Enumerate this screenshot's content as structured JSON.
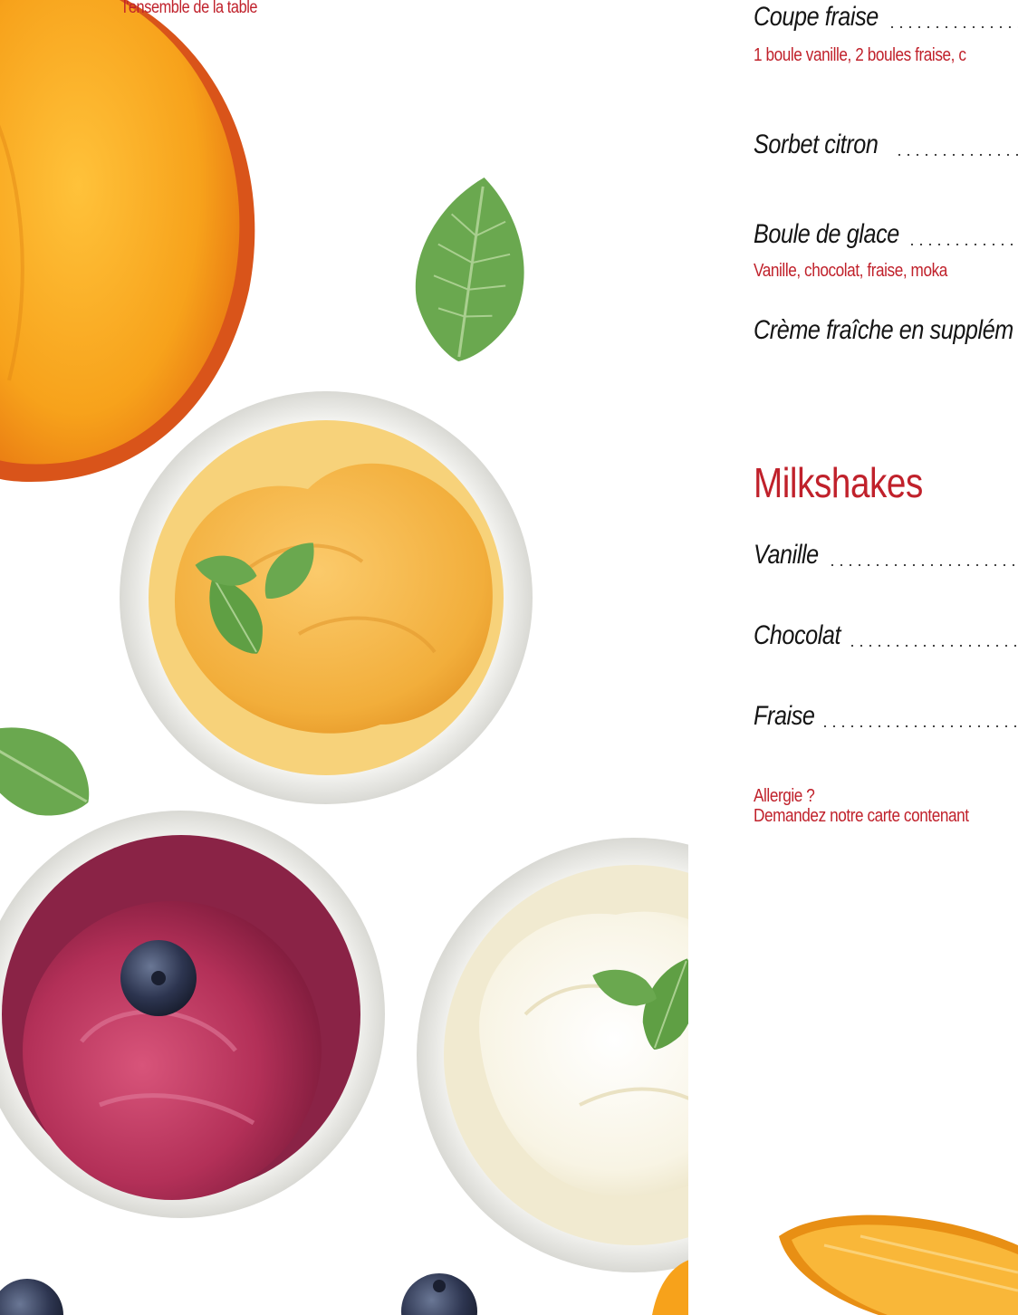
{
  "top_note": "l'ensemble de la table",
  "menu": {
    "items": [
      {
        "name": "Coupe fraise",
        "desc": "1 boule vanille, 2 boules fraise, c"
      },
      {
        "name": "Sorbet citron",
        "desc": ""
      },
      {
        "name": "Boule de glace",
        "desc": "Vanille, chocolat, fraise, moka"
      },
      {
        "name": "Crème fraîche en supplém",
        "desc": ""
      }
    ],
    "section_title": "Milkshakes",
    "milkshakes": [
      {
        "name": "Vanille"
      },
      {
        "name": "Chocolat"
      },
      {
        "name": "Fraise"
      }
    ],
    "allergy_line1": "Allergie ?",
    "allergy_line2": "Demandez notre carte contenant"
  },
  "colors": {
    "accent": "#c0212b",
    "mango": "#f6a821",
    "mango_ice": "#f4b446",
    "berry": "#a3264a",
    "vanilla": "#f6f1df",
    "mint": "#6aa84f",
    "orange": "#f7a21b",
    "blueberry": "#2d3550"
  }
}
